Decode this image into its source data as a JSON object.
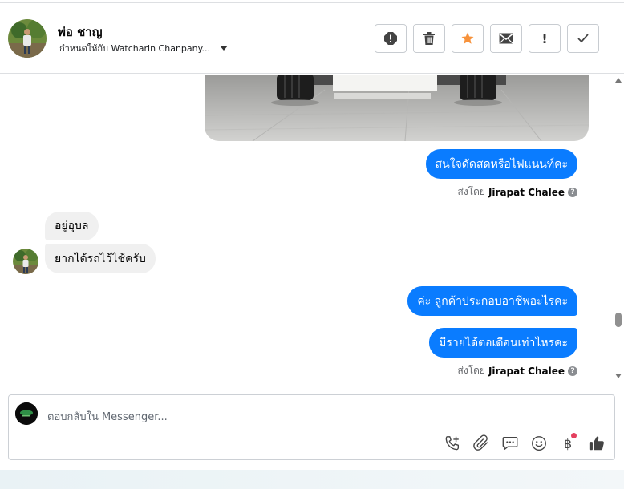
{
  "header": {
    "name": "พ่อ ชาญ",
    "assigned_to": "กำหนดให้กับ Watcharin Chanpany...",
    "actions": [
      {
        "name": "report-icon"
      },
      {
        "name": "trash-icon"
      },
      {
        "name": "star-icon",
        "color": "#f7923b"
      },
      {
        "name": "envelope-icon"
      },
      {
        "name": "exclamation-icon",
        "glyph": "!"
      },
      {
        "name": "check-icon"
      }
    ]
  },
  "thread": {
    "outgoing_1": "สนใจดัดสดหรือไฟแนนท์คะ",
    "sent_by_1": {
      "prefix": "ส่งโดย",
      "agent": "Jirapat Chalee"
    },
    "incoming_1": "อยู่อุบล",
    "incoming_2": "ยากได้รถไว้ไช้ครับ",
    "outgoing_2": "ค่ะ ลูกค้าประกอบอาชีพอะไรคะ",
    "outgoing_3": "มีรายได้ต่อเดือนเท่าไหร่คะ",
    "sent_by_2": {
      "prefix": "ส่งโดย",
      "agent": "Jirapat Chalee"
    },
    "help_glyph": "?"
  },
  "composer": {
    "placeholder": "ตอบกลับใน Messenger...",
    "baht_glyph": "฿",
    "tools": [
      "phone-plus-icon",
      "paperclip-icon",
      "chat-bubble-icon",
      "smiley-icon",
      "baht-icon",
      "thumbs-up-icon"
    ]
  },
  "colors": {
    "accent": "#0a7cff",
    "incoming": "#f0f0f0",
    "star": "#f7923b",
    "notify": "#e4405f"
  }
}
